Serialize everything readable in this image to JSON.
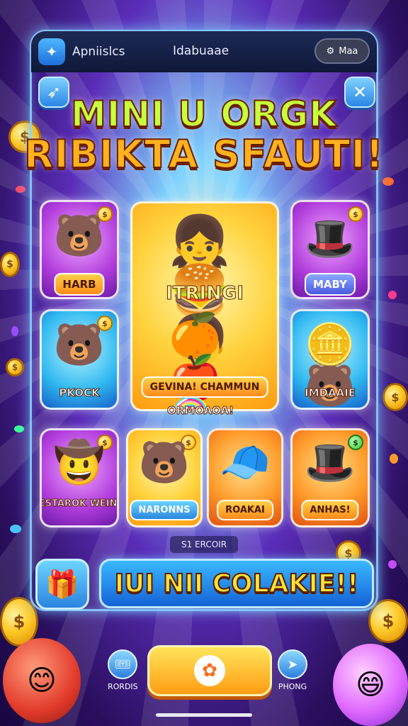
{
  "header": {
    "app_name": "Apniislcs",
    "tab_title": "Idabuaae",
    "settings_label": "Maa",
    "settings_icon": "gear-icon"
  },
  "top_buttons": {
    "left_icon": "rocket-icon",
    "close_icon": "close-icon"
  },
  "headline": {
    "line1": "MINI U ORGK",
    "line2": "RIBIKTA SFAUTI!"
  },
  "cards": [
    {
      "label": "HARB",
      "art": "bear",
      "theme": "purple"
    },
    {
      "label": "ITRINGI",
      "art": "friends",
      "theme": "gold"
    },
    {
      "label": "MABY",
      "art": "candy-hat",
      "theme": "purple"
    },
    {
      "label": "PKOCK",
      "art": "bear-coins",
      "theme": "cyan"
    },
    {
      "label": "GEVINA! CHAMMUN",
      "art": "fruit",
      "theme": "gold"
    },
    {
      "label": "IMDAAIE",
      "art": "coins-bear",
      "theme": "cyan"
    },
    {
      "label": "RESTAROK WEINIT",
      "art": "bear-hat",
      "theme": "purple"
    },
    {
      "label": "NARONNS",
      "art": "green-bear",
      "theme": "gold"
    },
    {
      "label": "ROAKAI",
      "art": "red-hat",
      "theme": "orange"
    },
    {
      "label": "ANHAS!",
      "art": "blue-hat",
      "theme": "orange"
    }
  ],
  "card_subtitle": "ORMOAOA!",
  "status_text": "S1 ERCOIR",
  "banner_text": "IUI NII COLAKIE!!",
  "bottom_nav": {
    "left_label": "RORDIS",
    "right_label": "PHONG"
  },
  "colors": {
    "accent_blue": "#2b86e6",
    "accent_gold": "#ffc928",
    "headline_green": "#c8ff3c",
    "headline_orange": "#ffb21e"
  }
}
